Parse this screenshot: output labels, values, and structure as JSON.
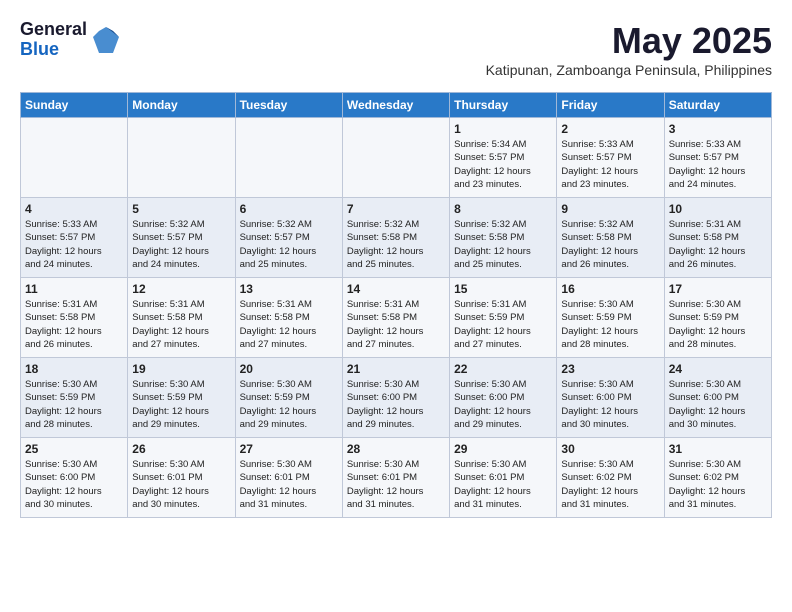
{
  "logo": {
    "general": "General",
    "blue": "Blue"
  },
  "title": "May 2025",
  "subtitle": "Katipunan, Zamboanga Peninsula, Philippines",
  "headers": [
    "Sunday",
    "Monday",
    "Tuesday",
    "Wednesday",
    "Thursday",
    "Friday",
    "Saturday"
  ],
  "weeks": [
    [
      {
        "day": "",
        "info": ""
      },
      {
        "day": "",
        "info": ""
      },
      {
        "day": "",
        "info": ""
      },
      {
        "day": "",
        "info": ""
      },
      {
        "day": "1",
        "info": "Sunrise: 5:34 AM\nSunset: 5:57 PM\nDaylight: 12 hours\nand 23 minutes."
      },
      {
        "day": "2",
        "info": "Sunrise: 5:33 AM\nSunset: 5:57 PM\nDaylight: 12 hours\nand 23 minutes."
      },
      {
        "day": "3",
        "info": "Sunrise: 5:33 AM\nSunset: 5:57 PM\nDaylight: 12 hours\nand 24 minutes."
      }
    ],
    [
      {
        "day": "4",
        "info": "Sunrise: 5:33 AM\nSunset: 5:57 PM\nDaylight: 12 hours\nand 24 minutes."
      },
      {
        "day": "5",
        "info": "Sunrise: 5:32 AM\nSunset: 5:57 PM\nDaylight: 12 hours\nand 24 minutes."
      },
      {
        "day": "6",
        "info": "Sunrise: 5:32 AM\nSunset: 5:57 PM\nDaylight: 12 hours\nand 25 minutes."
      },
      {
        "day": "7",
        "info": "Sunrise: 5:32 AM\nSunset: 5:58 PM\nDaylight: 12 hours\nand 25 minutes."
      },
      {
        "day": "8",
        "info": "Sunrise: 5:32 AM\nSunset: 5:58 PM\nDaylight: 12 hours\nand 25 minutes."
      },
      {
        "day": "9",
        "info": "Sunrise: 5:32 AM\nSunset: 5:58 PM\nDaylight: 12 hours\nand 26 minutes."
      },
      {
        "day": "10",
        "info": "Sunrise: 5:31 AM\nSunset: 5:58 PM\nDaylight: 12 hours\nand 26 minutes."
      }
    ],
    [
      {
        "day": "11",
        "info": "Sunrise: 5:31 AM\nSunset: 5:58 PM\nDaylight: 12 hours\nand 26 minutes."
      },
      {
        "day": "12",
        "info": "Sunrise: 5:31 AM\nSunset: 5:58 PM\nDaylight: 12 hours\nand 27 minutes."
      },
      {
        "day": "13",
        "info": "Sunrise: 5:31 AM\nSunset: 5:58 PM\nDaylight: 12 hours\nand 27 minutes."
      },
      {
        "day": "14",
        "info": "Sunrise: 5:31 AM\nSunset: 5:58 PM\nDaylight: 12 hours\nand 27 minutes."
      },
      {
        "day": "15",
        "info": "Sunrise: 5:31 AM\nSunset: 5:59 PM\nDaylight: 12 hours\nand 27 minutes."
      },
      {
        "day": "16",
        "info": "Sunrise: 5:30 AM\nSunset: 5:59 PM\nDaylight: 12 hours\nand 28 minutes."
      },
      {
        "day": "17",
        "info": "Sunrise: 5:30 AM\nSunset: 5:59 PM\nDaylight: 12 hours\nand 28 minutes."
      }
    ],
    [
      {
        "day": "18",
        "info": "Sunrise: 5:30 AM\nSunset: 5:59 PM\nDaylight: 12 hours\nand 28 minutes."
      },
      {
        "day": "19",
        "info": "Sunrise: 5:30 AM\nSunset: 5:59 PM\nDaylight: 12 hours\nand 29 minutes."
      },
      {
        "day": "20",
        "info": "Sunrise: 5:30 AM\nSunset: 5:59 PM\nDaylight: 12 hours\nand 29 minutes."
      },
      {
        "day": "21",
        "info": "Sunrise: 5:30 AM\nSunset: 6:00 PM\nDaylight: 12 hours\nand 29 minutes."
      },
      {
        "day": "22",
        "info": "Sunrise: 5:30 AM\nSunset: 6:00 PM\nDaylight: 12 hours\nand 29 minutes."
      },
      {
        "day": "23",
        "info": "Sunrise: 5:30 AM\nSunset: 6:00 PM\nDaylight: 12 hours\nand 30 minutes."
      },
      {
        "day": "24",
        "info": "Sunrise: 5:30 AM\nSunset: 6:00 PM\nDaylight: 12 hours\nand 30 minutes."
      }
    ],
    [
      {
        "day": "25",
        "info": "Sunrise: 5:30 AM\nSunset: 6:00 PM\nDaylight: 12 hours\nand 30 minutes."
      },
      {
        "day": "26",
        "info": "Sunrise: 5:30 AM\nSunset: 6:01 PM\nDaylight: 12 hours\nand 30 minutes."
      },
      {
        "day": "27",
        "info": "Sunrise: 5:30 AM\nSunset: 6:01 PM\nDaylight: 12 hours\nand 31 minutes."
      },
      {
        "day": "28",
        "info": "Sunrise: 5:30 AM\nSunset: 6:01 PM\nDaylight: 12 hours\nand 31 minutes."
      },
      {
        "day": "29",
        "info": "Sunrise: 5:30 AM\nSunset: 6:01 PM\nDaylight: 12 hours\nand 31 minutes."
      },
      {
        "day": "30",
        "info": "Sunrise: 5:30 AM\nSunset: 6:02 PM\nDaylight: 12 hours\nand 31 minutes."
      },
      {
        "day": "31",
        "info": "Sunrise: 5:30 AM\nSunset: 6:02 PM\nDaylight: 12 hours\nand 31 minutes."
      }
    ]
  ]
}
